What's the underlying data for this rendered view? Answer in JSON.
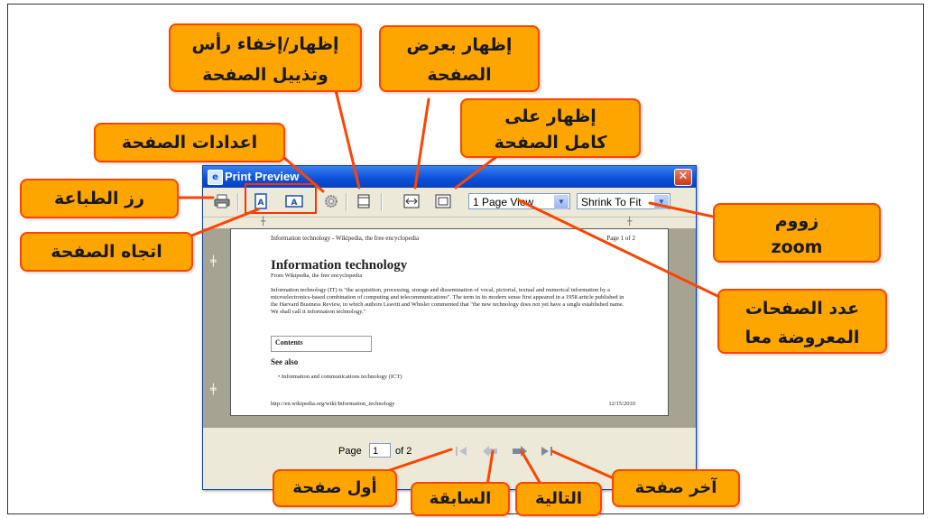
{
  "window": {
    "title": "Print Preview",
    "close_glyph": "✕",
    "icon": "print-preview-app-icon"
  },
  "toolbar": {
    "page_view": "1 Page View",
    "zoom": "Shrink To Fit",
    "buttons": [
      "print-icon",
      "portrait-icon",
      "landscape-icon",
      "page-setup-icon",
      "header-footer-icon",
      "page-width-icon",
      "full-page-icon"
    ]
  },
  "page": {
    "header_left": "Information technology - Wikipedia, the free encyclopedia",
    "header_right": "Page 1 of 2",
    "title": "Information technology",
    "from": "From Wikipedia, the free encyclopedia",
    "body": "Information technology (IT) is \"the acquisition, processing, storage and dissemination of vocal, pictorial, textual and numerical information by a microelectronics-based combination of computing and telecommunications\". The term in its modern sense first appeared in a 1958 article published in the Harvard Business Review, in which authors Leavitt and Whisler commented that \"the new technology does not yet have a single established name. We shall call it information technology.\"",
    "contents": "Contents",
    "see_also": "See also",
    "bullet": "Information and communications technology (ICT)",
    "footer_left": "http://en.wikipedia.org/wiki/Information_technology",
    "footer_right": "12/15/2010"
  },
  "nav": {
    "page_label": "Page",
    "page_value": "1",
    "of_label": "of 2"
  },
  "callouts": {
    "print": "رز الطباعة",
    "orientation": "اتجاه الصفحة",
    "page_setup": "اعدادات الصفحة",
    "header_footer_1": "إظهار/إخفاء رأس",
    "header_footer_2": "وتذييل الصفحة",
    "page_width_1": "إظهار بعرض",
    "page_width_2": "الصفحة",
    "full_page_1": "إظهار على",
    "full_page_2": "كامل الصفحة",
    "zoom_1": "زووم",
    "zoom_2": "zoom",
    "pages_shown_1": "عدد الصفحات",
    "pages_shown_2": "المعروضة معا",
    "first_page": "أول صفحة",
    "previous": "السابقة",
    "next": "التالية",
    "last_page": "آخر صفحة"
  },
  "colors": {
    "callout_fill": "#ffa500",
    "callout_border": "#ff4400",
    "titlebar": "#0a4fd8",
    "preview_bg": "#a6a393"
  }
}
